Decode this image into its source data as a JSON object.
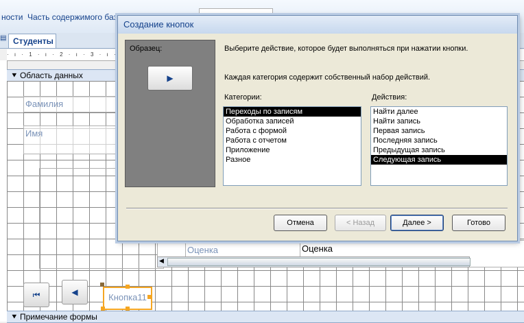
{
  "app": {
    "ribbon_items": [
      "ности",
      "Часть содержимого баз"
    ],
    "doc_tab": "Студенты",
    "ruler_text": "· ı · 1 · ı · 2 · ı · 3 · ı · 4 · ı · 5",
    "section_data": "Область данных",
    "section_footer": "Примечание формы",
    "fields": {
      "familiya": "Фамилия",
      "imya": "Имя",
      "ocenka_label": "Оценка",
      "ocenka_value": "Оценка"
    },
    "nav_first_glyph": "⏮",
    "nav_prev_glyph": "◀",
    "button_new": "Кнопка11"
  },
  "dialog": {
    "title": "Создание кнопок",
    "sample_label": "Образец:",
    "sample_glyph": "▶",
    "instruction1": "Выберите действие, которое будет выполняться при нажатии кнопки.",
    "instruction2": "Каждая категория содержит собственный набор действий.",
    "categories_label": "Категории:",
    "actions_label": "Действия:",
    "categories": [
      {
        "label": "Переходы по записям",
        "selected": true
      },
      {
        "label": "Обработка записей",
        "selected": false
      },
      {
        "label": "Работа с формой",
        "selected": false
      },
      {
        "label": "Работа с отчетом",
        "selected": false
      },
      {
        "label": "Приложение",
        "selected": false
      },
      {
        "label": "Разное",
        "selected": false
      }
    ],
    "actions": [
      {
        "label": "Найти далее",
        "selected": false
      },
      {
        "label": "Найти запись",
        "selected": false
      },
      {
        "label": "Первая запись",
        "selected": false
      },
      {
        "label": "Последняя запись",
        "selected": false
      },
      {
        "label": "Предыдущая запись",
        "selected": false
      },
      {
        "label": "Следующая запись",
        "selected": true
      }
    ],
    "buttons": {
      "cancel": "Отмена",
      "back": "< Назад",
      "next": "Далее >",
      "finish": "Готово"
    }
  }
}
